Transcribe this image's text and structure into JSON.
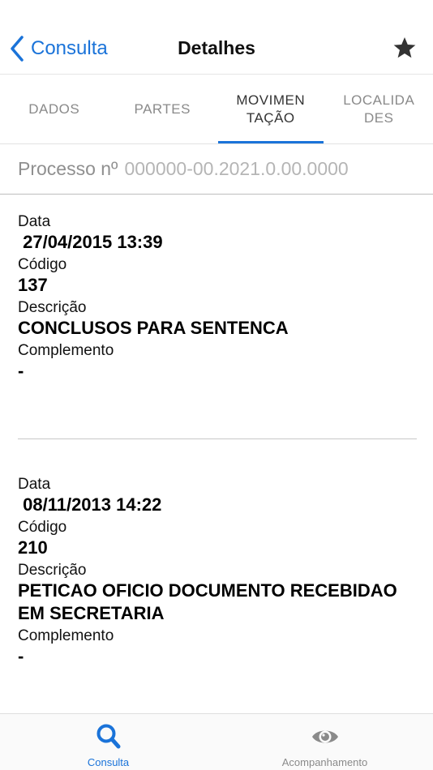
{
  "nav": {
    "back_label": "Consulta",
    "title": "Detalhes"
  },
  "tabs": [
    {
      "label": "DADOS"
    },
    {
      "label": "PARTES"
    },
    {
      "label": "MOVIMEN\nTAÇÃO",
      "active": true
    },
    {
      "label": "LOCALIDA\nDES"
    }
  ],
  "process": {
    "label": "Processo nº",
    "number": "000000-00.2021.0.00.0000"
  },
  "entries": [
    {
      "data_label": "Data",
      "data_value": " 27/04/2015 13:39",
      "codigo_label": "Código",
      "codigo_value": "137",
      "descricao_label": "Descrição",
      "descricao_value": "CONCLUSOS PARA SENTENCA",
      "complemento_label": "Complemento",
      "complemento_value": "-"
    },
    {
      "data_label": "Data",
      "data_value": " 08/11/2013 14:22",
      "codigo_label": "Código",
      "codigo_value": "210",
      "descricao_label": "Descrição",
      "descricao_value": "PETICAO OFICIO DOCUMENTO RECEBIDAO EM SECRETARIA",
      "complemento_label": "Complemento",
      "complemento_value": "-"
    }
  ],
  "tabbar": {
    "items": [
      {
        "label": "Consulta",
        "icon": "search-icon",
        "active": true
      },
      {
        "label": "Acompanhamento",
        "icon": "eye-icon",
        "active": false
      }
    ]
  },
  "colors": {
    "accent": "#1a73d9",
    "muted": "#8a8a8a"
  }
}
